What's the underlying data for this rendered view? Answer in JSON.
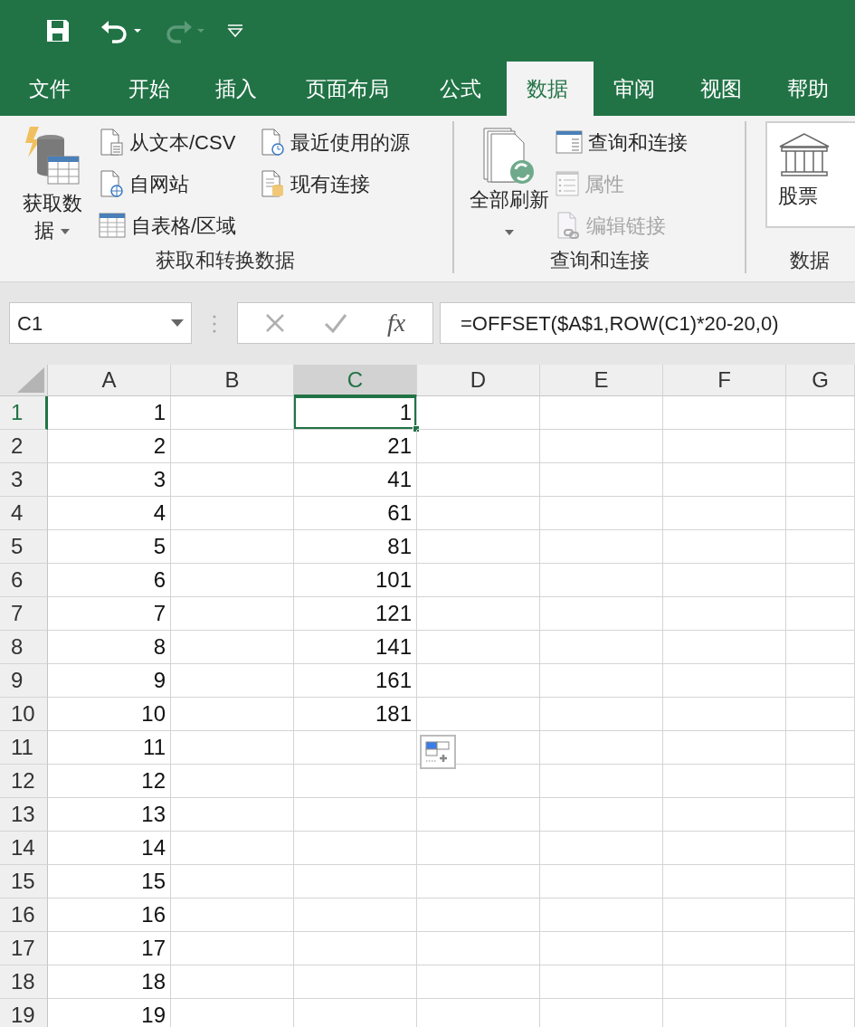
{
  "quick_access": [
    {
      "kind": "save",
      "disabled": false
    },
    {
      "kind": "undo",
      "disabled": false
    },
    {
      "kind": "redo",
      "disabled": true
    },
    {
      "kind": "customize",
      "disabled": false
    }
  ],
  "tabs": [
    {
      "label": "文件",
      "selected": false
    },
    {
      "label": "开始",
      "selected": false
    },
    {
      "label": "插入",
      "selected": false
    },
    {
      "label": "页面布局",
      "selected": false
    },
    {
      "label": "公式",
      "selected": false
    },
    {
      "label": "数据",
      "selected": true
    },
    {
      "label": "审阅",
      "selected": false
    },
    {
      "label": "视图",
      "selected": false
    },
    {
      "label": "帮助",
      "selected": false
    }
  ],
  "ribbon": {
    "groups": [
      {
        "label": "获取和转换数据",
        "items": [
          {
            "label": "获取数据",
            "kind": "large",
            "disabled": false
          },
          {
            "label": "从文本/CSV",
            "kind": "small",
            "disabled": false
          },
          {
            "label": "自网站",
            "kind": "small",
            "disabled": false
          },
          {
            "label": "自表格/区域",
            "kind": "small",
            "disabled": false
          },
          {
            "label": "最近使用的源",
            "kind": "small",
            "disabled": false
          },
          {
            "label": "现有连接",
            "kind": "small",
            "disabled": false
          }
        ]
      },
      {
        "label": "查询和连接",
        "items": [
          {
            "label": "全部刷新",
            "kind": "large",
            "disabled": false
          },
          {
            "label": "查询和连接",
            "kind": "small",
            "disabled": false
          },
          {
            "label": "属性",
            "kind": "small",
            "disabled": true
          },
          {
            "label": "编辑链接",
            "kind": "small",
            "disabled": true
          }
        ]
      },
      {
        "label": "数据",
        "items": [
          {
            "label": "股票",
            "kind": "boxed",
            "disabled": false
          }
        ]
      }
    ]
  },
  "formula_bar": {
    "name_box": "C1",
    "function_label": "fx",
    "formula": "=OFFSET($A$1,ROW(C1)*20-20,0)"
  },
  "columns": [
    {
      "label": "A",
      "selected": false
    },
    {
      "label": "B",
      "selected": false
    },
    {
      "label": "C",
      "selected": true
    },
    {
      "label": "D",
      "selected": false
    },
    {
      "label": "E",
      "selected": false
    },
    {
      "label": "F",
      "selected": false
    },
    {
      "label": "G",
      "selected": false
    }
  ],
  "rows": [
    {
      "number": "1",
      "selected": true,
      "column_a": "1",
      "column_c": "1"
    },
    {
      "number": "2",
      "selected": false,
      "column_a": "2",
      "column_c": "21"
    },
    {
      "number": "3",
      "selected": false,
      "column_a": "3",
      "column_c": "41"
    },
    {
      "number": "4",
      "selected": false,
      "column_a": "4",
      "column_c": "61"
    },
    {
      "number": "5",
      "selected": false,
      "column_a": "5",
      "column_c": "81"
    },
    {
      "number": "6",
      "selected": false,
      "column_a": "6",
      "column_c": "101"
    },
    {
      "number": "7",
      "selected": false,
      "column_a": "7",
      "column_c": "121"
    },
    {
      "number": "8",
      "selected": false,
      "column_a": "8",
      "column_c": "141"
    },
    {
      "number": "9",
      "selected": false,
      "column_a": "9",
      "column_c": "161"
    },
    {
      "number": "10",
      "selected": false,
      "column_a": "10",
      "column_c": "181"
    },
    {
      "number": "11",
      "selected": false,
      "column_a": "11"
    },
    {
      "number": "12",
      "selected": false,
      "column_a": "12"
    },
    {
      "number": "13",
      "selected": false,
      "column_a": "13"
    },
    {
      "number": "14",
      "selected": false,
      "column_a": "14"
    },
    {
      "number": "15",
      "selected": false,
      "column_a": "15"
    },
    {
      "number": "16",
      "selected": false,
      "column_a": "16"
    },
    {
      "number": "17",
      "selected": false,
      "column_a": "17"
    },
    {
      "number": "18",
      "selected": false,
      "column_a": "18"
    },
    {
      "number": "19",
      "selected": false,
      "column_a": "19"
    }
  ]
}
